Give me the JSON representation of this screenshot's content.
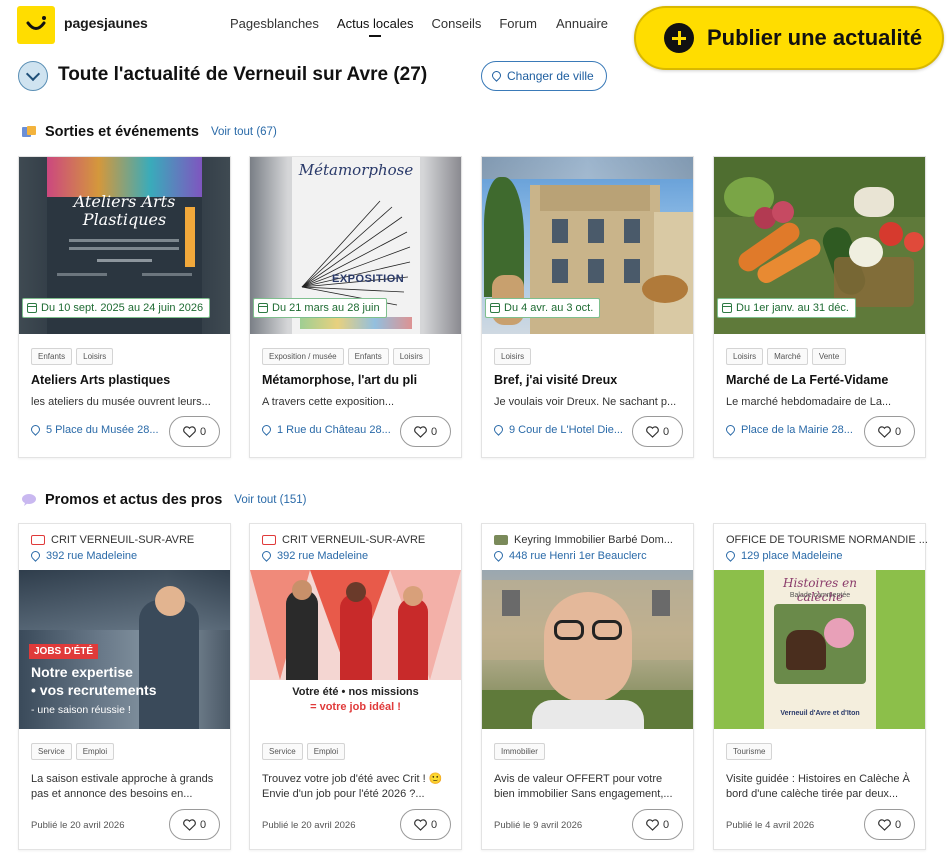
{
  "header": {
    "brand": "pagesjaunes",
    "nav": [
      "Pagesblanches",
      "Actus locales",
      "Conseils",
      "Forum"
    ],
    "nav_clipped": "Annuaire",
    "publish_label": "Publier une actualité"
  },
  "title": {
    "text": "Toute l'actualité de Verneuil sur Avre (27)",
    "change_city": "Changer de ville"
  },
  "events": {
    "title": "Sorties et événements",
    "more": "Voir tout (67)",
    "cards": [
      {
        "date": "Du 10 sept. 2025 au 24 juin 2026",
        "tags": [
          "Enfants",
          "Loisirs"
        ],
        "title": "Ateliers Arts plastiques",
        "desc": "les ateliers du musée ouvrent leurs...",
        "addr": "5 Place du Musée 28...",
        "likes": "0",
        "poster": {
          "line1": "Ateliers Arts",
          "line2": "Plastiques",
          "bg": "#2f3a44"
        }
      },
      {
        "date": "Du 21 mars au 28 juin",
        "tags": [
          "Exposition / musée",
          "Enfants",
          "Loisirs"
        ],
        "title": "Métamorphose, l'art du pli",
        "desc": "A travers cette exposition...",
        "addr": "1 Rue du Château 28...",
        "likes": "0",
        "poster": {
          "line1": "Métamorphose",
          "line2": "EXPOSITION",
          "bg": "#e8e8ea"
        }
      },
      {
        "date": "Du 4 avr. au 3 oct.",
        "tags": [
          "Loisirs"
        ],
        "title": "Bref, j'ai visité Dreux",
        "desc": "Je voulais voir Dreux. Ne sachant p...",
        "addr": "9 Cour de L'Hotel Die...",
        "likes": "0"
      },
      {
        "date": "Du 1er janv. au 31 déc.",
        "tags": [
          "Loisirs",
          "Marché",
          "Vente"
        ],
        "title": "Marché de La Ferté-Vidame",
        "desc": "Le marché hebdomadaire de La...",
        "addr": "Place de la Mairie 28...",
        "likes": "0"
      }
    ]
  },
  "promos": {
    "title": "Promos et actus des pros",
    "more": "Voir tout (151)",
    "cards": [
      {
        "org": "CRIT VERNEUIL-SUR-AVRE",
        "addr": "392 rue Madeleine",
        "overlay": {
          "badge": "JOBS D'ÉTÉ",
          "line1": "Notre expertise",
          "line2": "• vos recrutements",
          "line3": "- une saison réussie !"
        },
        "tags": [
          "Service",
          "Emploi"
        ],
        "desc": "La saison estivale approche à grands pas et annonce des besoins en...",
        "date": "Publié le 20 avril 2026",
        "likes": "0"
      },
      {
        "org": "CRIT VERNEUIL-SUR-AVRE",
        "addr": "392 rue Madeleine",
        "overlay": {
          "line1": "Votre été • nos missions",
          "line2": "= votre job idéal !"
        },
        "tags": [
          "Service",
          "Emploi"
        ],
        "desc": "Trouvez votre job d'été avec Crit ! 🙂 Envie d'un job pour l'été 2026 ?...",
        "date": "Publié le 20 avril 2026",
        "likes": "0"
      },
      {
        "org": "Keyring Immobilier Barbé Dom...",
        "addr": "448 rue Henri 1er Beauclerc",
        "tags": [
          "Immobilier"
        ],
        "desc": "Avis de valeur OFFERT pour votre bien immobilier Sans engagement,...",
        "date": "Publié le 9 avril 2026",
        "likes": "0"
      },
      {
        "org": "OFFICE DE TOURISME NORMANDIE ...",
        "addr": "129 place Madeleine",
        "overlay": {
          "line1": "Histoires en calèche",
          "line2": "Balade commentée",
          "line3": "Verneuil d'Avre et d'Iton"
        },
        "tags": [
          "Tourisme"
        ],
        "desc": "Visite guidée : Histoires en Calèche À bord d'une calèche tirée par deux...",
        "date": "Publié le 4 avril 2026",
        "likes": "0"
      }
    ]
  }
}
